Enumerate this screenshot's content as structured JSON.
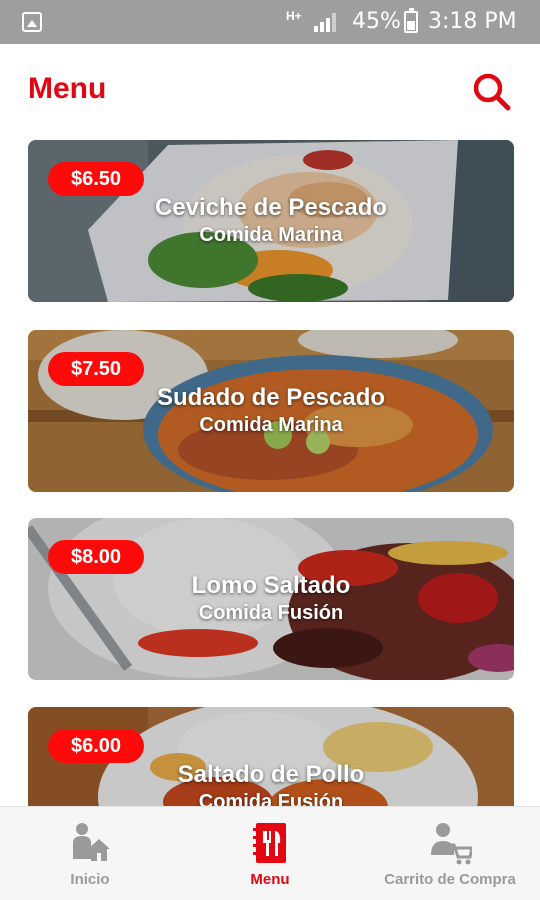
{
  "status_bar": {
    "network": "H+",
    "battery": "45%",
    "time": "3:18 PM"
  },
  "header": {
    "title": "Menu",
    "search_icon": "search-icon"
  },
  "colors": {
    "accent": "#e30613",
    "price_badge": "#ff0a0a",
    "nav_inactive": "#9a9a9a"
  },
  "menu_items": [
    {
      "price": "$6.50",
      "name": "Ceviche de Pescado",
      "category": "Comida Marina"
    },
    {
      "price": "$7.50",
      "name": "Sudado de Pescado",
      "category": "Comida Marina"
    },
    {
      "price": "$8.00",
      "name": "Lomo Saltado",
      "category": "Comida Fusión"
    },
    {
      "price": "$6.00",
      "name": "Saltado de Pollo",
      "category": "Comida Fusión"
    }
  ],
  "bottom_nav": {
    "items": [
      {
        "label": "Inicio",
        "icon": "home-user-icon"
      },
      {
        "label": "Menu",
        "icon": "menu-book-icon"
      },
      {
        "label": "Carrito de Compra",
        "icon": "cart-user-icon"
      }
    ],
    "active": "Menu"
  }
}
